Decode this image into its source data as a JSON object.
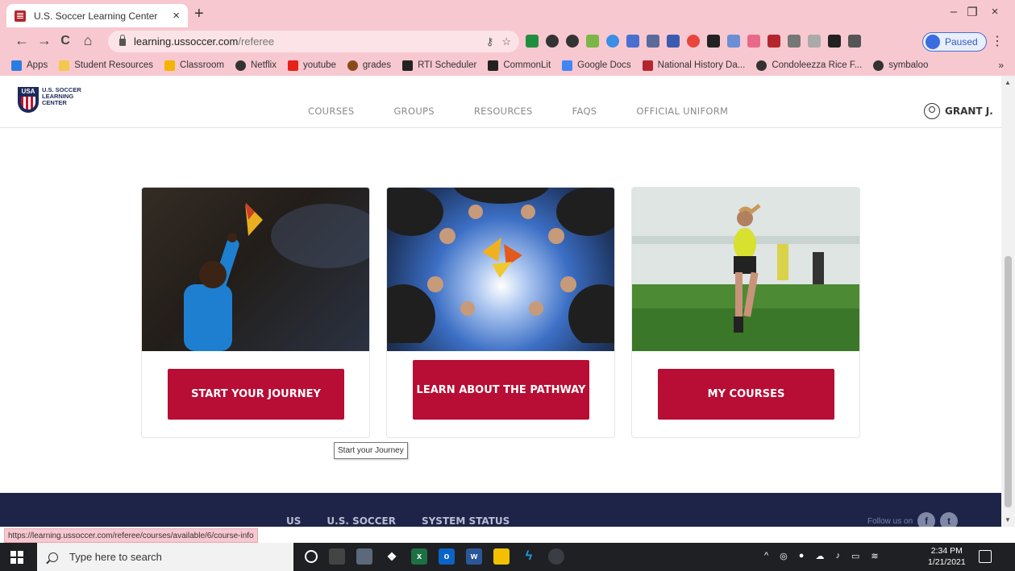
{
  "browser": {
    "tab_title": "U.S. Soccer Learning Center",
    "tab_close": "×",
    "new_tab": "+",
    "window_controls": {
      "minimize": "–",
      "restore": "❐",
      "close": "×"
    },
    "nav": {
      "back": "←",
      "forward": "→",
      "reload": "C",
      "home": "⌂"
    },
    "url_host": "learning.ussoccer.com",
    "url_path": "/referee",
    "profile_status": "Paused",
    "menu": "⋮"
  },
  "bookmarks": [
    {
      "label": "Apps",
      "color": "#2a7de1"
    },
    {
      "label": "Student Resources",
      "color": "#f2c94c"
    },
    {
      "label": "Classroom",
      "color": "#f5b400"
    },
    {
      "label": "Netflix",
      "color": "#333333"
    },
    {
      "label": "youtube",
      "color": "#e62117"
    },
    {
      "label": "grades",
      "color": "#8a4a1a"
    },
    {
      "label": "RTI Scheduler",
      "color": "#222222"
    },
    {
      "label": "CommonLit",
      "color": "#222222"
    },
    {
      "label": "Google Docs",
      "color": "#4285f4"
    },
    {
      "label": "National History Da...",
      "color": "#b3262e"
    },
    {
      "label": "Condoleezza Rice F...",
      "color": "#333333"
    },
    {
      "label": "symbaloo",
      "color": "#333333"
    }
  ],
  "bookmarks_more": "»",
  "site": {
    "logo_text": "U.S. SOCCER LEARNING CENTER",
    "nav": [
      "COURSES",
      "GROUPS",
      "RESOURCES",
      "FAQS",
      "OFFICIAL UNIFORM"
    ],
    "user_name": "GRANT J."
  },
  "cards": [
    {
      "button": "START YOUR JOURNEY",
      "image": "referee-with-flag"
    },
    {
      "button": "LEARN ABOUT THE PATHWAY",
      "image": "referees-huddle-flags"
    },
    {
      "button": "MY COURSES",
      "image": "referee-running-field"
    }
  ],
  "tooltip": "Start your Journey",
  "footer": {
    "links": [
      "US",
      "U.S. SOCCER",
      "SYSTEM STATUS"
    ],
    "follow_label": "Follow us on",
    "social": [
      "f",
      "t"
    ]
  },
  "status_url": "https://learning.ussoccer.com/referee/courses/available/6/course-info",
  "taskbar": {
    "search_placeholder": "Type here to search",
    "time": "2:34 PM",
    "date": "1/21/2021"
  },
  "colors": {
    "accent": "#b80d34",
    "footer": "#1e2447",
    "chrome": "#f8c8d0"
  }
}
